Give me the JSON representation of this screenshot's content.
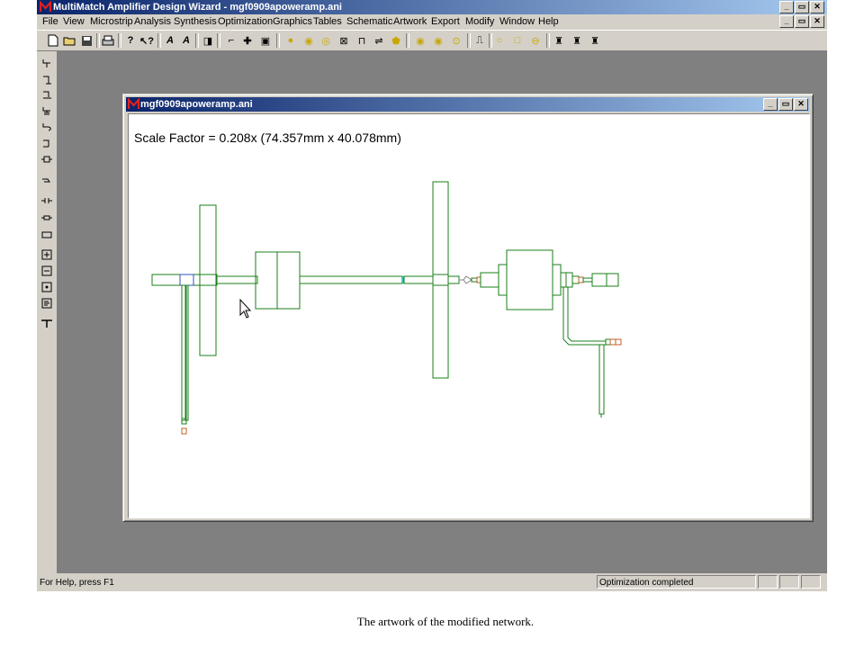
{
  "app": {
    "title": "MultiMatch Amplifier Design Wizard - mgf0909apoweramp.ani",
    "title_buttons": [
      "_",
      "▭",
      "✕"
    ],
    "mdi_buttons": [
      "_",
      "▭",
      "✕"
    ]
  },
  "menu": [
    "File",
    "View",
    "Microstrip",
    "Analysis",
    "Synthesis",
    "Optimization",
    "Graphics",
    "Tables",
    "Schematic",
    "Artwork",
    "Export",
    "Modify",
    "Window",
    "Help"
  ],
  "toolbar_icons": [
    "new-file-icon",
    "open-folder-icon",
    "save-icon",
    "print-icon",
    "help-icon",
    "context-help-icon",
    "line-tool-icon",
    "curve-tool-icon",
    "component-icon",
    "microstrip-bend-icon",
    "cross-junction-icon",
    "element-icon",
    "circle-yellow-icon",
    "circle-f-icon",
    "circle-s-icon",
    "box-x-icon",
    "tee-icon",
    "coupler-icon",
    "open-stub-icon",
    "circle-y-icon",
    "circle-c-icon",
    "circle-dot-icon",
    "pulse-icon",
    "circle-icon",
    "square-icon",
    "circle-minus-icon",
    "amplifier-a-icon",
    "amplifier-b-icon",
    "amplifier-c-icon"
  ],
  "left_tools": [
    "series-element-icon",
    "shunt-element-icon",
    "shunt-stub-icon",
    "shunt-cap-icon",
    "shunt-l-icon",
    "shunt-open-icon",
    "series-line-icon",
    "series-cap-icon",
    "coupled-line-icon",
    "series-r-icon",
    "series-box-icon",
    "plus-box-icon",
    "minus-box-icon",
    "dot-box-icon",
    "mem-box-icon",
    "probe-icon"
  ],
  "child": {
    "title": "mgf0909apoweramp.ani",
    "scale_factor": "Scale Factor =  0.208x (74.357mm x 40.078mm)"
  },
  "status": {
    "help": "For Help, press F1",
    "message": "Optimization completed"
  },
  "caption": "The artwork of the modified network.",
  "colors": {
    "title_active": "#0a246a",
    "trace": "#1a7f1a",
    "face": "#d4d0c8"
  }
}
